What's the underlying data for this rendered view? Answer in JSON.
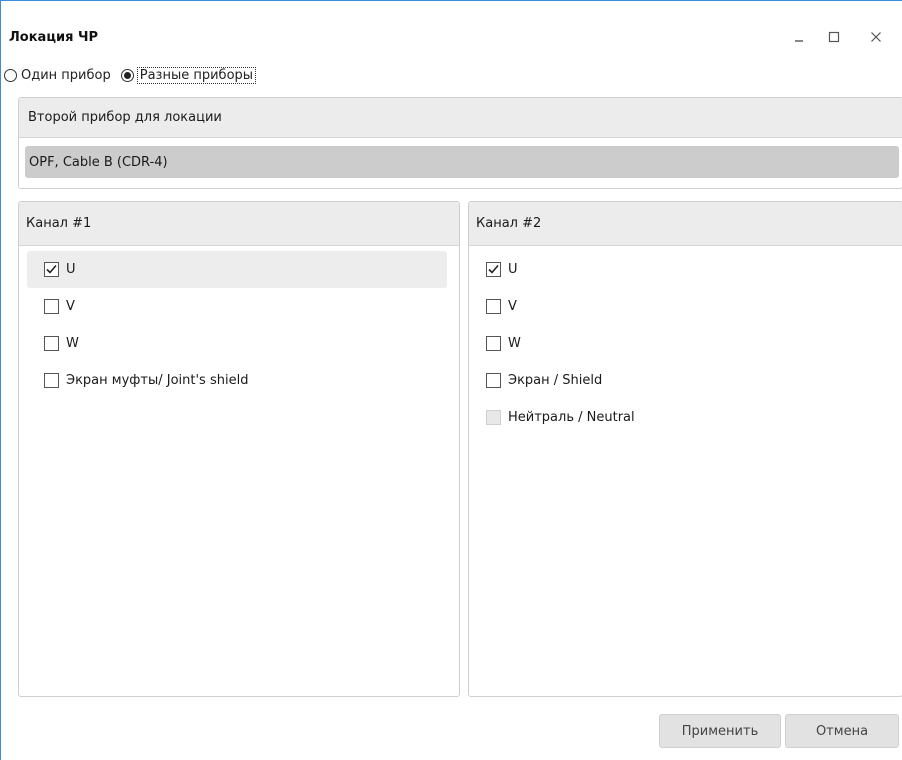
{
  "window": {
    "title": "Локация ЧР",
    "minimize_label": "_",
    "maximize_label": "☐",
    "close_label": "✕"
  },
  "mode": {
    "options": [
      {
        "label": "Один прибор",
        "selected": false
      },
      {
        "label": "Разные приборы",
        "selected": true
      }
    ]
  },
  "device": {
    "header": "Второй прибор для локации",
    "selected_value": "OPF, Cable B (CDR-4)"
  },
  "channels": [
    {
      "header": "Канал #1",
      "items": [
        {
          "label": "U",
          "checked": true,
          "enabled": true
        },
        {
          "label": "V",
          "checked": false,
          "enabled": true
        },
        {
          "label": "W",
          "checked": false,
          "enabled": true
        },
        {
          "label": "Экран муфты/ Joint's shield",
          "checked": false,
          "enabled": true
        }
      ]
    },
    {
      "header": "Канал #2",
      "items": [
        {
          "label": "U",
          "checked": true,
          "enabled": true
        },
        {
          "label": "V",
          "checked": false,
          "enabled": true
        },
        {
          "label": "W",
          "checked": false,
          "enabled": true
        },
        {
          "label": "Экран / Shield",
          "checked": false,
          "enabled": true
        },
        {
          "label": "Нейтраль / Neutral",
          "checked": false,
          "enabled": false
        }
      ]
    }
  ],
  "buttons": {
    "apply_label": "Применить",
    "cancel_label": "Отмена"
  },
  "colors": {
    "window_border": "#3c8dd9",
    "header_bg": "#ececec",
    "select_bg": "#cccccc",
    "button_bg": "#e2e2e2"
  }
}
